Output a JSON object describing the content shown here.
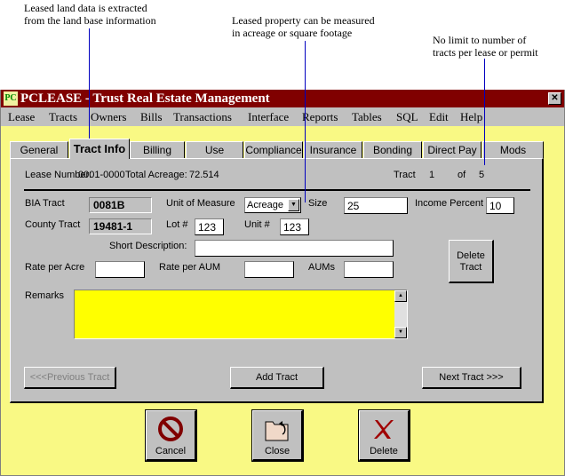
{
  "notes": [
    "Leased land data is extracted",
    "from the land base information",
    "Leased property can be measured",
    "in acreage or square footage",
    "No limit to number of",
    "tracts per lease or permit"
  ],
  "window": {
    "title": "PCLEASE - Trust Real Estate Management",
    "close": "✕"
  },
  "menu": [
    "Lease",
    "Tracts",
    "Owners",
    "Bills",
    "Transactions",
    "Interface",
    "Reports",
    "Tables",
    "SQL",
    "Edit",
    "Help"
  ],
  "tabs": [
    "General",
    "Tract Info",
    "Billing",
    "Use",
    "Compliance",
    "Insurance",
    "Bonding",
    "Direct Pay",
    "Mods"
  ],
  "header": {
    "lease_label": "Lease Number:",
    "lease_value": "0001-0000",
    "acreage_label": "Total Acreage:",
    "acreage_value": "72.514",
    "tract_label": "Tract",
    "tract_value": "1",
    "of_label": "of",
    "of_value": "5"
  },
  "form": {
    "bia_label": "BIA Tract",
    "bia_value": "0081B",
    "uom_label": "Unit of Measure",
    "uom_value": "Acreage",
    "size_label": "Size",
    "size_value": "25",
    "income_label": "Income Percent",
    "income_value": "10",
    "county_label": "County Tract",
    "county_value": "19481-1",
    "lot_label": "Lot #",
    "lot_value": "123",
    "unit_label": "Unit #",
    "unit_value": "123",
    "short_label": "Short Description:",
    "short_value": "",
    "rate_acre_label": "Rate per Acre",
    "rate_acre_value": "",
    "rate_aum_label": "Rate per AUM",
    "rate_aum_value": "",
    "aums_label": "AUMs",
    "aums_value": "",
    "remarks_label": "Remarks",
    "remarks_value": "",
    "remarks_color": "#ffff00"
  },
  "buttons": {
    "delete_tract_1": "Delete",
    "delete_tract_2": "Tract",
    "prev": "<<<Previous Tract",
    "add": "Add Tract",
    "next": "Next Tract >>>",
    "cancel": "Cancel",
    "close": "Close",
    "delete": "Delete"
  }
}
